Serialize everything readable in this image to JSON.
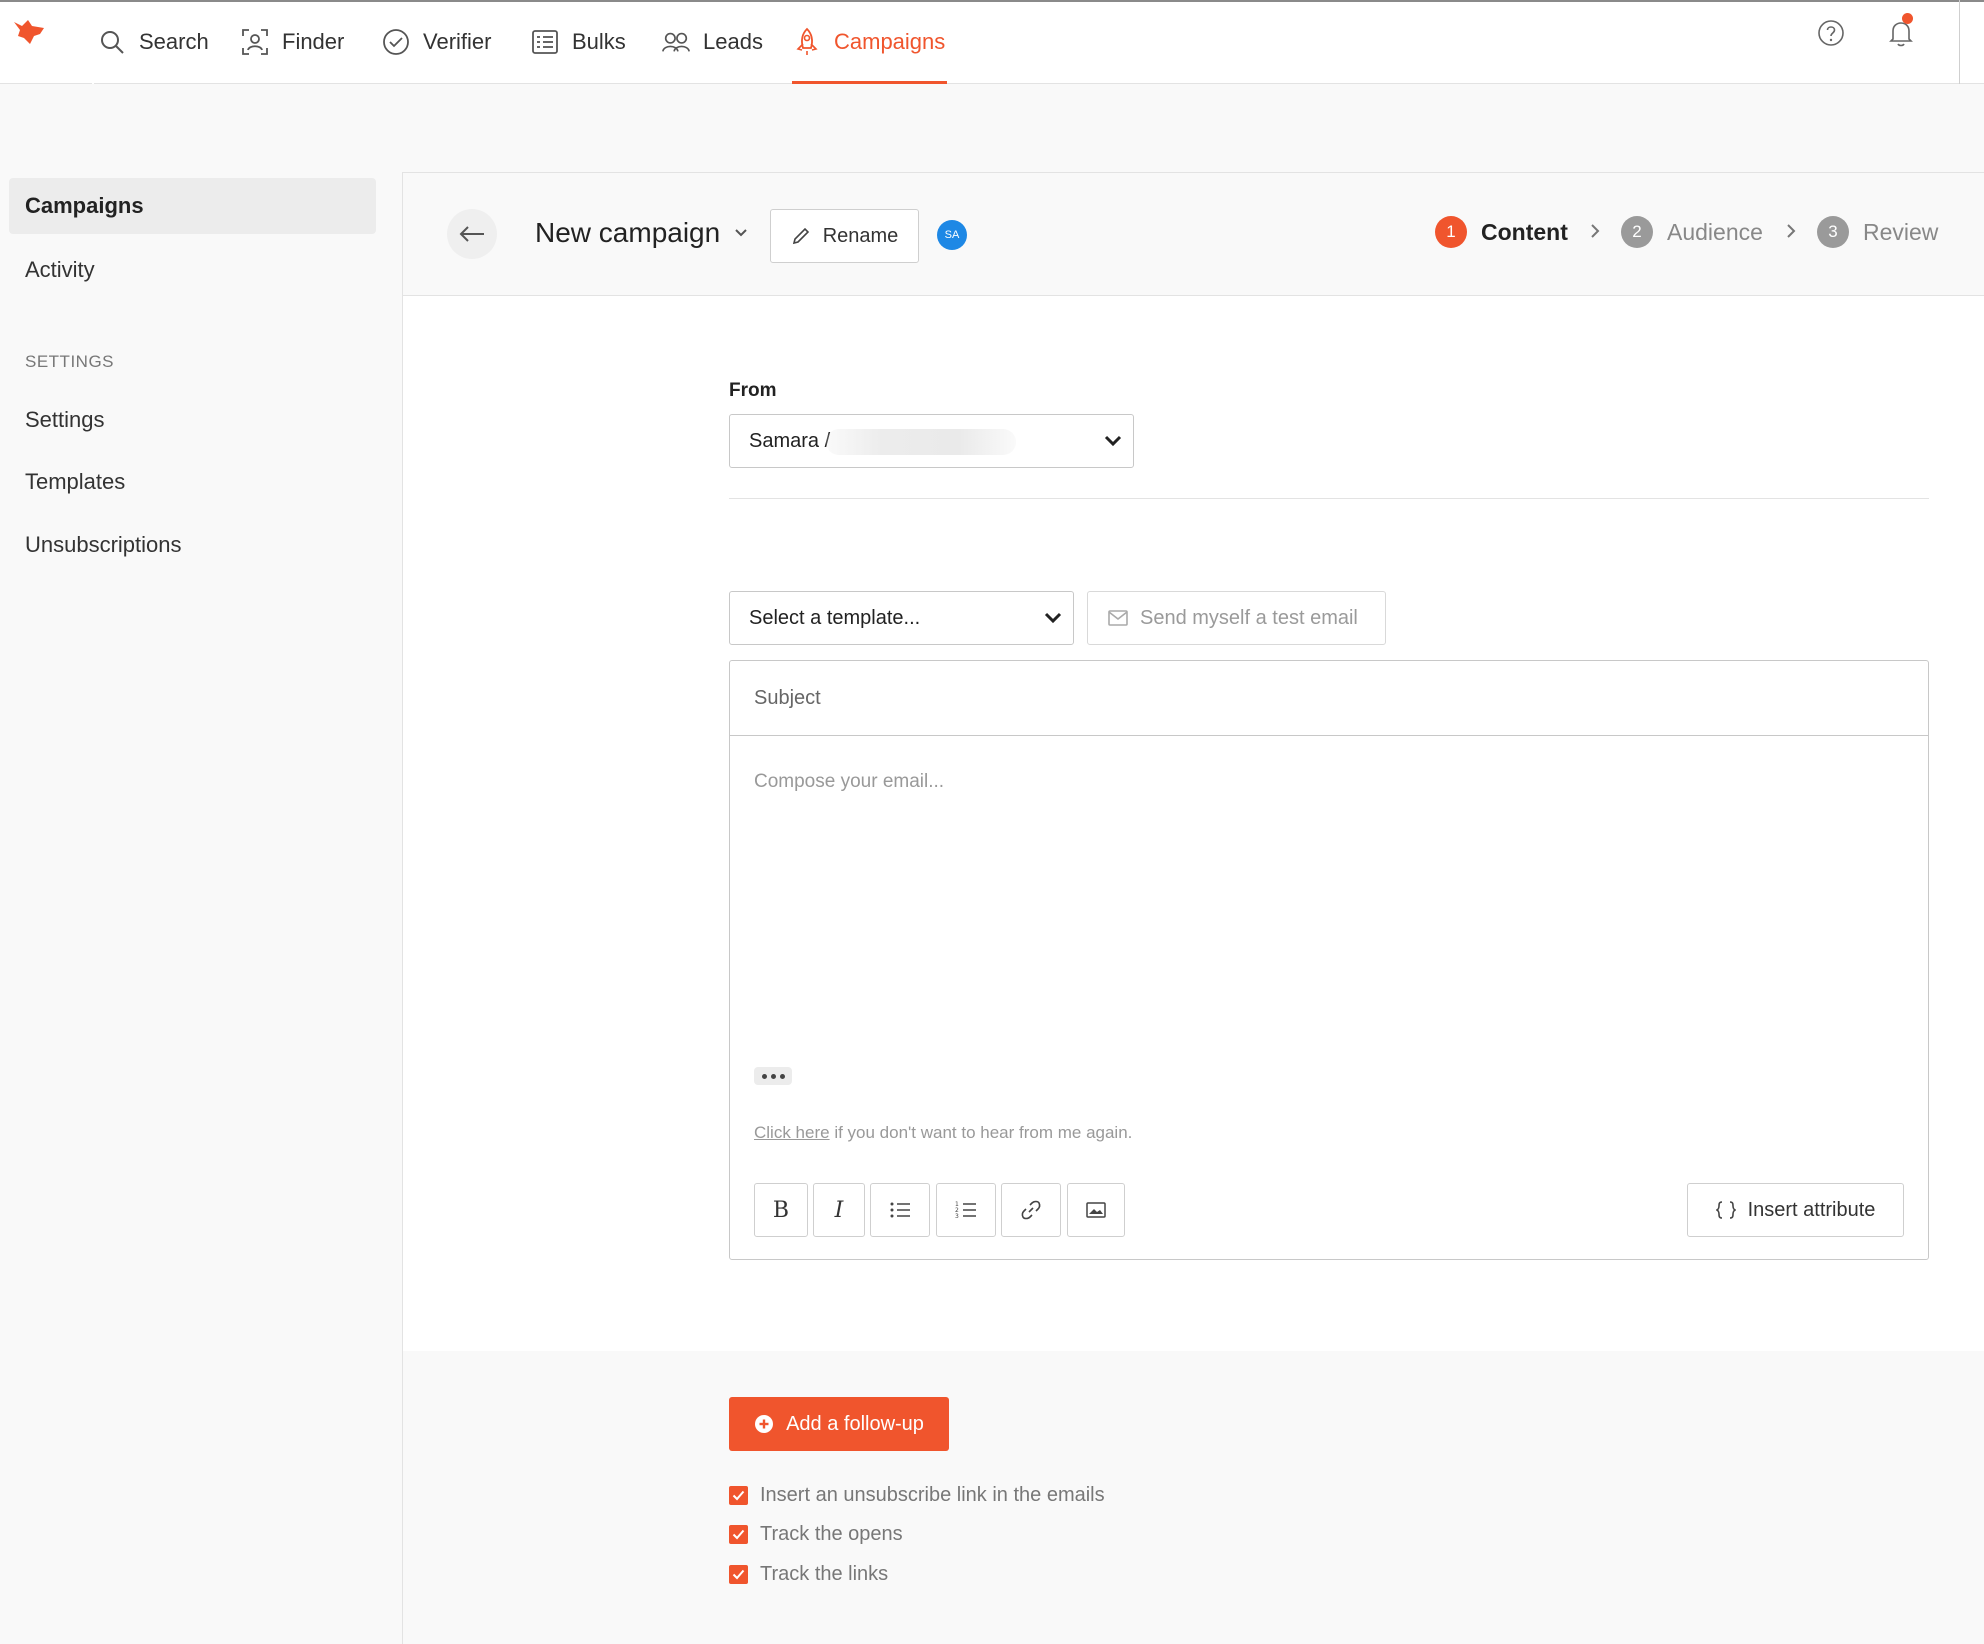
{
  "nav": {
    "items": [
      {
        "label": "Search",
        "icon": "search-icon"
      },
      {
        "label": "Finder",
        "icon": "finder-icon"
      },
      {
        "label": "Verifier",
        "icon": "verifier-icon"
      },
      {
        "label": "Bulks",
        "icon": "bulks-icon"
      },
      {
        "label": "Leads",
        "icon": "leads-icon"
      },
      {
        "label": "Campaigns",
        "icon": "rocket-icon",
        "active": true
      }
    ],
    "accent": "#f0552d"
  },
  "sidebar": {
    "items": [
      {
        "label": "Campaigns",
        "active": true
      },
      {
        "label": "Activity"
      }
    ],
    "settings_heading": "SETTINGS",
    "settings_items": [
      {
        "label": "Settings"
      },
      {
        "label": "Templates"
      },
      {
        "label": "Unsubscriptions"
      }
    ]
  },
  "header": {
    "title": "New campaign",
    "rename_label": "Rename",
    "avatar_initials": "SA",
    "steps": [
      {
        "num": "1",
        "label": "Content",
        "active": true
      },
      {
        "num": "2",
        "label": "Audience"
      },
      {
        "num": "3",
        "label": "Review"
      }
    ]
  },
  "form": {
    "from_label": "From",
    "from_value": "Samara /",
    "template_placeholder": "Select a template...",
    "test_email_label": "Send myself a test email",
    "subject_placeholder": "Subject",
    "compose_placeholder": "Compose your email...",
    "unsub_link": "Click here",
    "unsub_text": " if you don't want to hear from me again.",
    "toolbar": {
      "bold": "B",
      "italic": "I",
      "insert_attribute": "Insert attribute"
    }
  },
  "footer": {
    "followup_label": "Add a follow-up",
    "checkboxes": [
      {
        "label": "Insert an unsubscribe link in the emails",
        "checked": true
      },
      {
        "label": "Track the opens",
        "checked": true
      },
      {
        "label": "Track the links",
        "checked": true
      }
    ]
  }
}
